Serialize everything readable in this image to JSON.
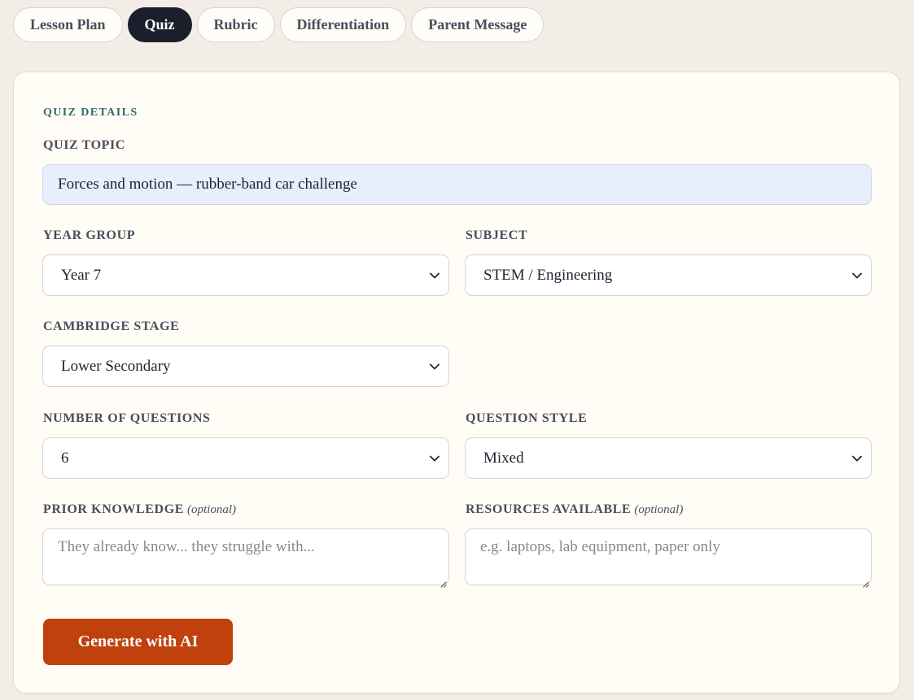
{
  "tabs": [
    {
      "label": "Lesson Plan",
      "active": false
    },
    {
      "label": "Quiz",
      "active": true
    },
    {
      "label": "Rubric",
      "active": false
    },
    {
      "label": "Differentiation",
      "active": false
    },
    {
      "label": "Parent Message",
      "active": false
    }
  ],
  "form": {
    "section_title": "QUIZ DETAILS",
    "quiz_topic": {
      "label": "QUIZ TOPIC",
      "value": "Forces and motion — rubber-band car challenge"
    },
    "year_group": {
      "label": "YEAR GROUP",
      "value": "Year 7"
    },
    "subject": {
      "label": "SUBJECT",
      "value": "STEM / Engineering"
    },
    "cambridge_stage": {
      "label": "CAMBRIDGE STAGE",
      "value": "Lower Secondary"
    },
    "num_questions": {
      "label": "NUMBER OF QUESTIONS",
      "value": "6"
    },
    "question_style": {
      "label": "QUESTION STYLE",
      "value": "Mixed"
    },
    "prior_knowledge": {
      "label": "PRIOR KNOWLEDGE",
      "optional": "(optional)",
      "placeholder": "They already know... they struggle with..."
    },
    "resources": {
      "label": "RESOURCES AVAILABLE",
      "optional": "(optional)",
      "placeholder": "e.g. laptops, lab equipment, paper only"
    },
    "generate_label": "Generate with AI"
  },
  "colors": {
    "page_bg": "#f2ede6",
    "card_bg": "#fffdf6",
    "active_tab": "#1c1f2b",
    "section_accent": "#2f6b6a",
    "primary_button": "#c0410e",
    "topic_input_bg": "#e7effc"
  },
  "icons": {
    "select_arrow": "chevron-down-icon",
    "textarea_resize": "resize-handle-icon"
  }
}
